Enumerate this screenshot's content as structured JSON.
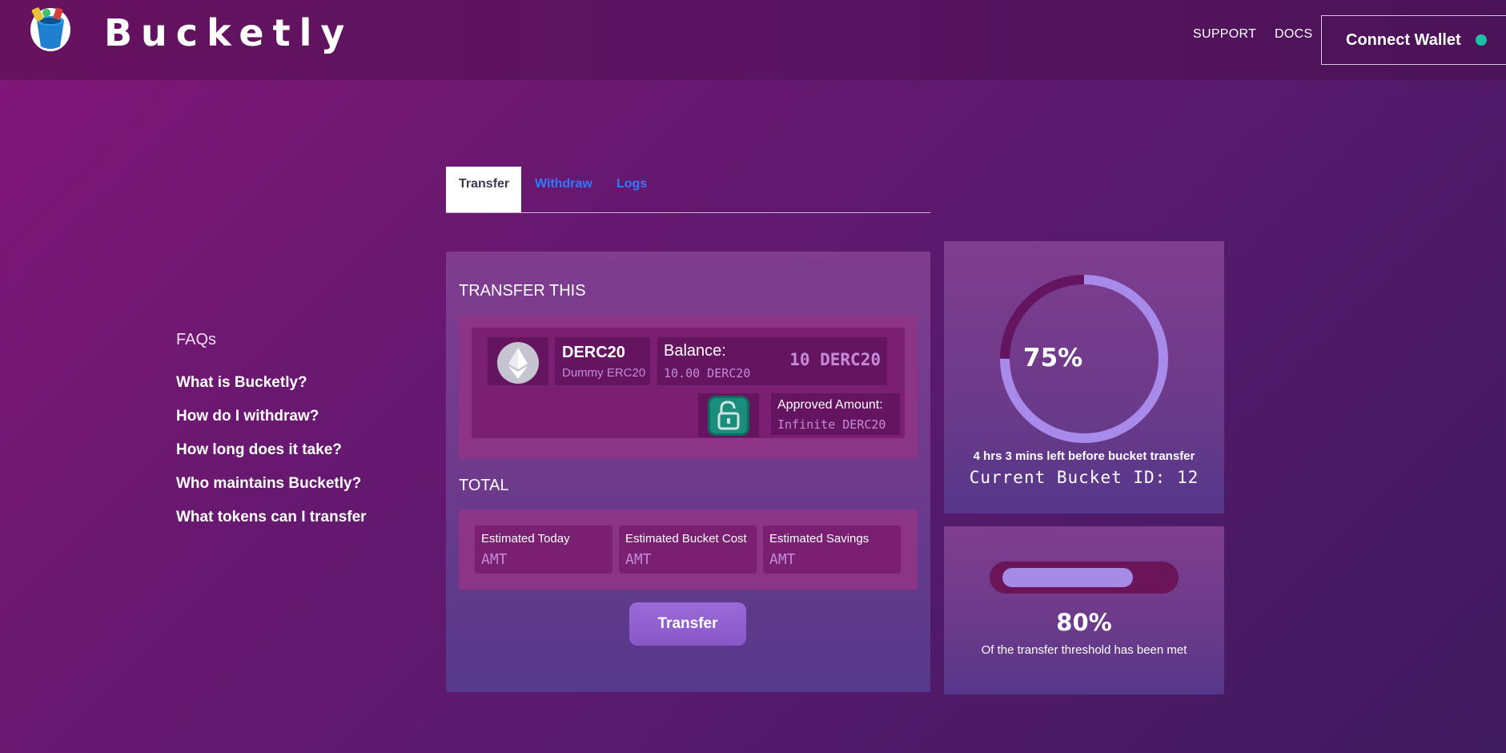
{
  "header": {
    "brand": "Bucketly",
    "nav": [
      "SUPPORT",
      "DOCS"
    ],
    "connect_label": "Connect Wallet",
    "status_color": "#19c2a6"
  },
  "faq": {
    "title": "FAQs",
    "items": [
      "What is Bucketly?",
      "How do I withdraw?",
      "How long does it take?",
      "Who maintains Bucketly?",
      "What tokens can I transfer"
    ]
  },
  "tabs": [
    "Transfer",
    "Withdraw",
    "Logs"
  ],
  "transfer": {
    "section_title": "TRANSFER THIS",
    "token_icon": "ethereum-icon",
    "token_name": "DERC20",
    "token_subtitle": "Dummy ERC20",
    "balance_label": "Balance:",
    "balance_sub": "10.00 DERC20",
    "balance_value": "10 DERC20",
    "lock_icon": "unlock-icon",
    "approved_label": "Approved Amount:",
    "approved_value": "Infinite DERC20"
  },
  "total": {
    "section_title": "TOTAL",
    "estimates": [
      {
        "label": "Estimated Today",
        "value": "AMT"
      },
      {
        "label": "Estimated Bucket Cost",
        "value": "AMT"
      },
      {
        "label": "Estimated Savings",
        "value": "AMT"
      }
    ],
    "button_label": "Transfer"
  },
  "bucket": {
    "progress_percent": 75,
    "percent_label": "75%",
    "time_left": "4 hrs 3 mins left before bucket transfer",
    "bucket_id": "Current Bucket ID: 12"
  },
  "threshold": {
    "progress_percent": 80,
    "percent_label": "80%",
    "description": "Of the transfer threshold has been met"
  }
}
